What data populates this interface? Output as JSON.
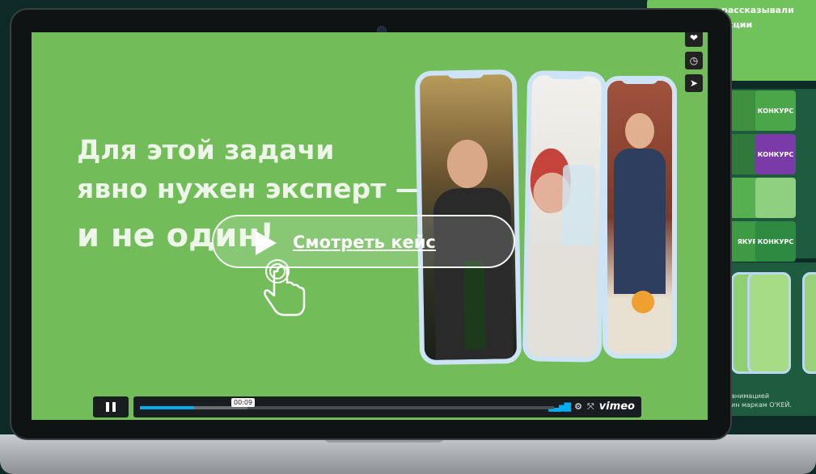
{
  "background": {
    "top_text_line1": "рассказывали",
    "top_text_line2": "укции",
    "tile_label": "КОНКУРС",
    "tile_label_2": "ЯКУРС",
    "caption_line1": "анимацией",
    "caption_line2": "ин маркам О'КЕЙ."
  },
  "slide": {
    "line1": "Для этой задачи",
    "line2": "явно нужен эксперт —",
    "line3": "и не один!"
  },
  "cta": {
    "label": "Смотреть кейс"
  },
  "player": {
    "time": "00:09",
    "progress_fraction": 0.13,
    "buffered_fraction": 0.26,
    "brand": "vimeo",
    "icons": [
      "heart-icon",
      "clock-icon",
      "send-icon",
      "pause-icon",
      "volume-bars-icon",
      "gear-icon",
      "fullscreen-icon"
    ]
  },
  "colors": {
    "slide_bg": "#72bd5a",
    "progress": "#00adef"
  }
}
